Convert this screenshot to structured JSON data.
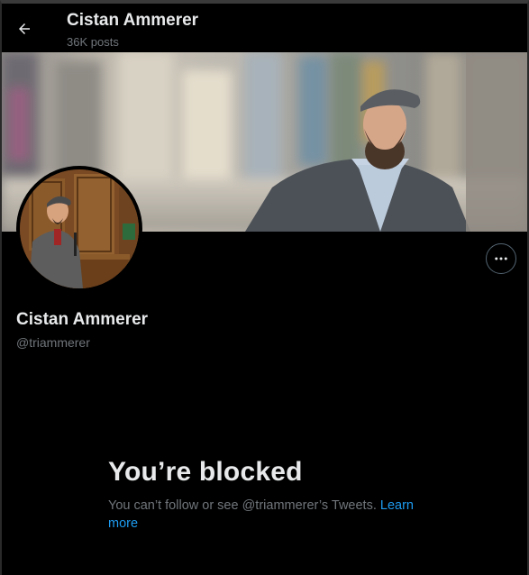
{
  "header": {
    "back_icon": "arrow-left-icon",
    "title": "Cistan Ammerer",
    "subtitle": "36K posts"
  },
  "profile": {
    "name": "Cistan Ammerer",
    "handle": "@triammerer",
    "more_icon": "ellipsis-icon"
  },
  "blocked": {
    "title": "You’re blocked",
    "message": "You can’t follow or see @triammerer’s Tweets. ",
    "link": "Learn more"
  },
  "colors": {
    "background": "#000000",
    "text_primary": "#e7e9ea",
    "text_secondary": "#71767b",
    "link": "#1d9bf0"
  }
}
